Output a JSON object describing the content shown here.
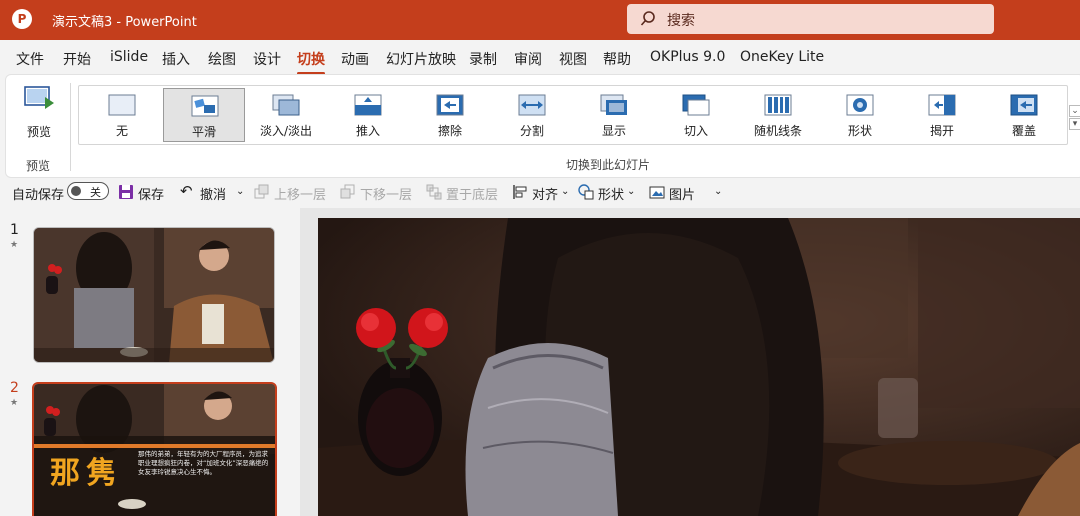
{
  "titlebar": {
    "logo_letter": "P",
    "title": "演示文稿3  -  PowerPoint",
    "search_placeholder": "搜索"
  },
  "menu": {
    "tabs": [
      "文件",
      "开始",
      "iSlide",
      "插入",
      "绘图",
      "设计",
      "切换",
      "动画",
      "幻灯片放映",
      "录制",
      "审阅",
      "视图",
      "帮助",
      "OKPlus 9.0",
      "OneKey Lite"
    ],
    "active": "切换"
  },
  "ribbon": {
    "preview_button": "预览",
    "preview_group": "预览",
    "transitions_group": "切换到此幻灯片",
    "transitions": [
      {
        "label": "无",
        "icon": "none-transition-icon"
      },
      {
        "label": "平滑",
        "icon": "morph-transition-icon",
        "selected": true
      },
      {
        "label": "淡入/淡出",
        "icon": "fade-transition-icon"
      },
      {
        "label": "推入",
        "icon": "push-transition-icon"
      },
      {
        "label": "擦除",
        "icon": "wipe-transition-icon"
      },
      {
        "label": "分割",
        "icon": "split-transition-icon"
      },
      {
        "label": "显示",
        "icon": "reveal-transition-icon"
      },
      {
        "label": "切入",
        "icon": "cut-transition-icon"
      },
      {
        "label": "随机线条",
        "icon": "random-bars-transition-icon"
      },
      {
        "label": "形状",
        "icon": "shape-transition-icon"
      },
      {
        "label": "揭开",
        "icon": "uncover-transition-icon"
      },
      {
        "label": "覆盖",
        "icon": "cover-transition-icon"
      }
    ]
  },
  "qat": {
    "autosave": "自动保存",
    "autosave_state": "关",
    "save": "保存",
    "undo": "撤消",
    "bring_forward": "上移一层",
    "send_backward": "下移一层",
    "send_to_back": "置于底层",
    "align": "对齐",
    "shape": "形状",
    "picture": "图片"
  },
  "slides": [
    {
      "number": "1",
      "star": "★"
    },
    {
      "number": "2",
      "star": "★",
      "title_text": "那隽",
      "body_text": "那伟的弟弟，年轻有为的大厂程序员，为追求职业理想疯狂内卷，对“加班文化”深恶痛绝的女友李玲锐意决心生不悔。"
    }
  ],
  "colors": {
    "accent": "#c43e1c",
    "ribbon_bg": "#ffffff",
    "app_bg": "#f3f3f3"
  }
}
